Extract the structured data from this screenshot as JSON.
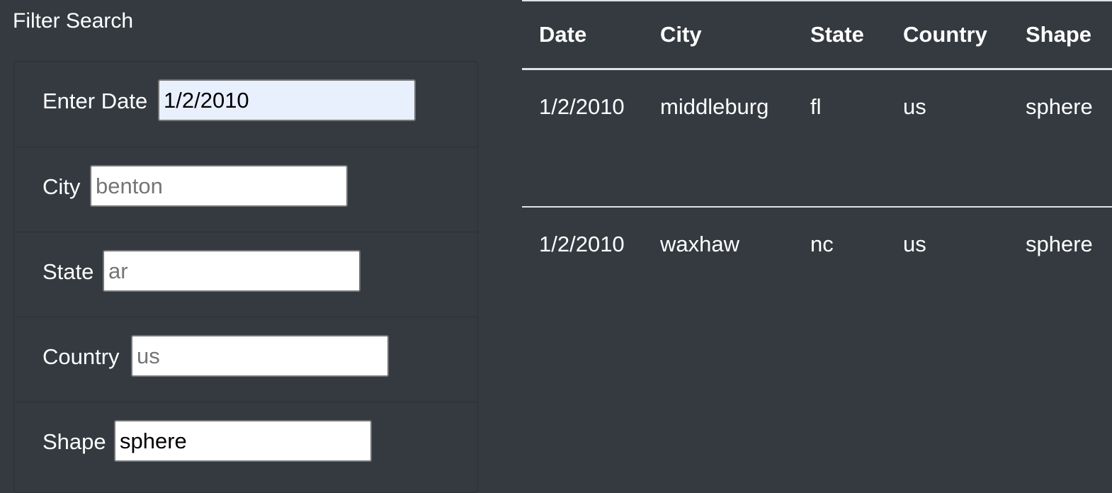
{
  "filter": {
    "title": "Filter Search",
    "fields": [
      {
        "label": "Enter Date",
        "value": "1/2/2010",
        "placeholder": ""
      },
      {
        "label": "City",
        "value": "",
        "placeholder": "benton"
      },
      {
        "label": "State",
        "value": "",
        "placeholder": "ar"
      },
      {
        "label": "Country",
        "value": "",
        "placeholder": "us"
      },
      {
        "label": "Shape",
        "value": "sphere",
        "placeholder": ""
      }
    ]
  },
  "table": {
    "columns": [
      "Date",
      "City",
      "State",
      "Country",
      "Shape"
    ],
    "rows": [
      [
        "1/2/2010",
        "middleburg",
        "fl",
        "us",
        "sphere"
      ],
      [
        "1/2/2010",
        "waxhaw",
        "nc",
        "us",
        "sphere"
      ]
    ]
  },
  "colors": {
    "background": "#343a40",
    "text": "#ffffff",
    "autofill_input": "#e8f0fe",
    "table_border": "#dee2e6"
  }
}
